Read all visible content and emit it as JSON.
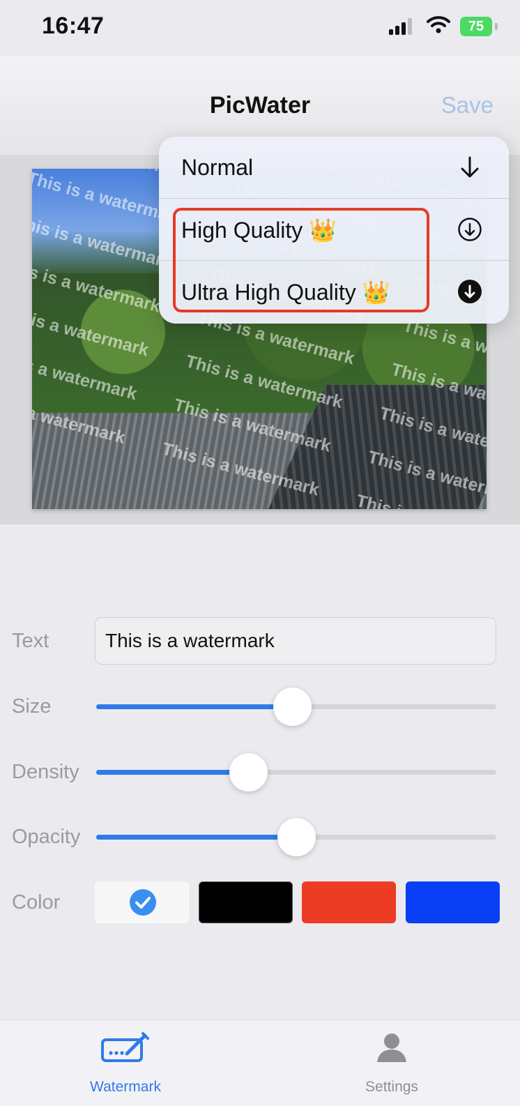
{
  "status_bar": {
    "time": "16:47",
    "battery": "75"
  },
  "header": {
    "title": "PicWater",
    "save_label": "Save"
  },
  "preview": {
    "watermark_text": "This is a watermark"
  },
  "quality_menu": {
    "items": [
      {
        "label": "Normal",
        "icon": "arrow-down-icon"
      },
      {
        "label": "High Quality 👑",
        "icon": "circle-arrow-down-icon"
      },
      {
        "label": "Ultra High Quality 👑",
        "icon": "filled-circle-arrow-down-icon"
      }
    ]
  },
  "controls": {
    "text_label": "Text",
    "text_value": "This is a watermark",
    "size_label": "Size",
    "size_value": 0.49,
    "density_label": "Density",
    "density_value": 0.38,
    "opacity_label": "Opacity",
    "opacity_value": 0.5,
    "color_label": "Color",
    "colors": [
      "#f7f7f8",
      "#000000",
      "#ec3c24",
      "#0a3ff5"
    ],
    "selected_color_index": 0
  },
  "tabbar": {
    "watermark_label": "Watermark",
    "settings_label": "Settings",
    "accent": "#2f7ae8",
    "inactive": "#8e8e93"
  }
}
